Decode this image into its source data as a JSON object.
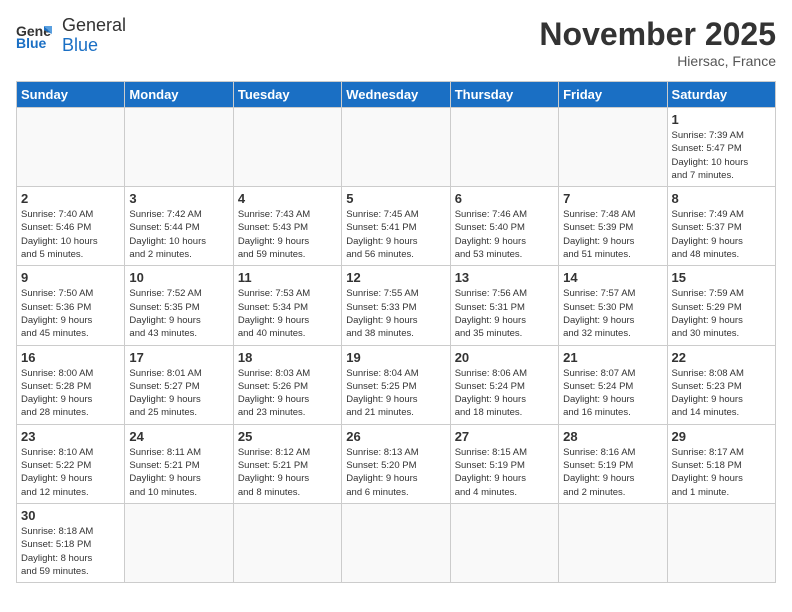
{
  "header": {
    "logo_general": "General",
    "logo_blue": "Blue",
    "month_title": "November 2025",
    "location": "Hiersac, France"
  },
  "weekdays": [
    "Sunday",
    "Monday",
    "Tuesday",
    "Wednesday",
    "Thursday",
    "Friday",
    "Saturday"
  ],
  "weeks": [
    [
      {
        "day": "",
        "info": ""
      },
      {
        "day": "",
        "info": ""
      },
      {
        "day": "",
        "info": ""
      },
      {
        "day": "",
        "info": ""
      },
      {
        "day": "",
        "info": ""
      },
      {
        "day": "",
        "info": ""
      },
      {
        "day": "1",
        "info": "Sunrise: 7:39 AM\nSunset: 5:47 PM\nDaylight: 10 hours\nand 7 minutes."
      }
    ],
    [
      {
        "day": "2",
        "info": "Sunrise: 7:40 AM\nSunset: 5:46 PM\nDaylight: 10 hours\nand 5 minutes."
      },
      {
        "day": "3",
        "info": "Sunrise: 7:42 AM\nSunset: 5:44 PM\nDaylight: 10 hours\nand 2 minutes."
      },
      {
        "day": "4",
        "info": "Sunrise: 7:43 AM\nSunset: 5:43 PM\nDaylight: 9 hours\nand 59 minutes."
      },
      {
        "day": "5",
        "info": "Sunrise: 7:45 AM\nSunset: 5:41 PM\nDaylight: 9 hours\nand 56 minutes."
      },
      {
        "day": "6",
        "info": "Sunrise: 7:46 AM\nSunset: 5:40 PM\nDaylight: 9 hours\nand 53 minutes."
      },
      {
        "day": "7",
        "info": "Sunrise: 7:48 AM\nSunset: 5:39 PM\nDaylight: 9 hours\nand 51 minutes."
      },
      {
        "day": "8",
        "info": "Sunrise: 7:49 AM\nSunset: 5:37 PM\nDaylight: 9 hours\nand 48 minutes."
      }
    ],
    [
      {
        "day": "9",
        "info": "Sunrise: 7:50 AM\nSunset: 5:36 PM\nDaylight: 9 hours\nand 45 minutes."
      },
      {
        "day": "10",
        "info": "Sunrise: 7:52 AM\nSunset: 5:35 PM\nDaylight: 9 hours\nand 43 minutes."
      },
      {
        "day": "11",
        "info": "Sunrise: 7:53 AM\nSunset: 5:34 PM\nDaylight: 9 hours\nand 40 minutes."
      },
      {
        "day": "12",
        "info": "Sunrise: 7:55 AM\nSunset: 5:33 PM\nDaylight: 9 hours\nand 38 minutes."
      },
      {
        "day": "13",
        "info": "Sunrise: 7:56 AM\nSunset: 5:31 PM\nDaylight: 9 hours\nand 35 minutes."
      },
      {
        "day": "14",
        "info": "Sunrise: 7:57 AM\nSunset: 5:30 PM\nDaylight: 9 hours\nand 32 minutes."
      },
      {
        "day": "15",
        "info": "Sunrise: 7:59 AM\nSunset: 5:29 PM\nDaylight: 9 hours\nand 30 minutes."
      }
    ],
    [
      {
        "day": "16",
        "info": "Sunrise: 8:00 AM\nSunset: 5:28 PM\nDaylight: 9 hours\nand 28 minutes."
      },
      {
        "day": "17",
        "info": "Sunrise: 8:01 AM\nSunset: 5:27 PM\nDaylight: 9 hours\nand 25 minutes."
      },
      {
        "day": "18",
        "info": "Sunrise: 8:03 AM\nSunset: 5:26 PM\nDaylight: 9 hours\nand 23 minutes."
      },
      {
        "day": "19",
        "info": "Sunrise: 8:04 AM\nSunset: 5:25 PM\nDaylight: 9 hours\nand 21 minutes."
      },
      {
        "day": "20",
        "info": "Sunrise: 8:06 AM\nSunset: 5:24 PM\nDaylight: 9 hours\nand 18 minutes."
      },
      {
        "day": "21",
        "info": "Sunrise: 8:07 AM\nSunset: 5:24 PM\nDaylight: 9 hours\nand 16 minutes."
      },
      {
        "day": "22",
        "info": "Sunrise: 8:08 AM\nSunset: 5:23 PM\nDaylight: 9 hours\nand 14 minutes."
      }
    ],
    [
      {
        "day": "23",
        "info": "Sunrise: 8:10 AM\nSunset: 5:22 PM\nDaylight: 9 hours\nand 12 minutes."
      },
      {
        "day": "24",
        "info": "Sunrise: 8:11 AM\nSunset: 5:21 PM\nDaylight: 9 hours\nand 10 minutes."
      },
      {
        "day": "25",
        "info": "Sunrise: 8:12 AM\nSunset: 5:21 PM\nDaylight: 9 hours\nand 8 minutes."
      },
      {
        "day": "26",
        "info": "Sunrise: 8:13 AM\nSunset: 5:20 PM\nDaylight: 9 hours\nand 6 minutes."
      },
      {
        "day": "27",
        "info": "Sunrise: 8:15 AM\nSunset: 5:19 PM\nDaylight: 9 hours\nand 4 minutes."
      },
      {
        "day": "28",
        "info": "Sunrise: 8:16 AM\nSunset: 5:19 PM\nDaylight: 9 hours\nand 2 minutes."
      },
      {
        "day": "29",
        "info": "Sunrise: 8:17 AM\nSunset: 5:18 PM\nDaylight: 9 hours\nand 1 minute."
      }
    ],
    [
      {
        "day": "30",
        "info": "Sunrise: 8:18 AM\nSunset: 5:18 PM\nDaylight: 8 hours\nand 59 minutes."
      },
      {
        "day": "",
        "info": ""
      },
      {
        "day": "",
        "info": ""
      },
      {
        "day": "",
        "info": ""
      },
      {
        "day": "",
        "info": ""
      },
      {
        "day": "",
        "info": ""
      },
      {
        "day": "",
        "info": ""
      }
    ]
  ]
}
